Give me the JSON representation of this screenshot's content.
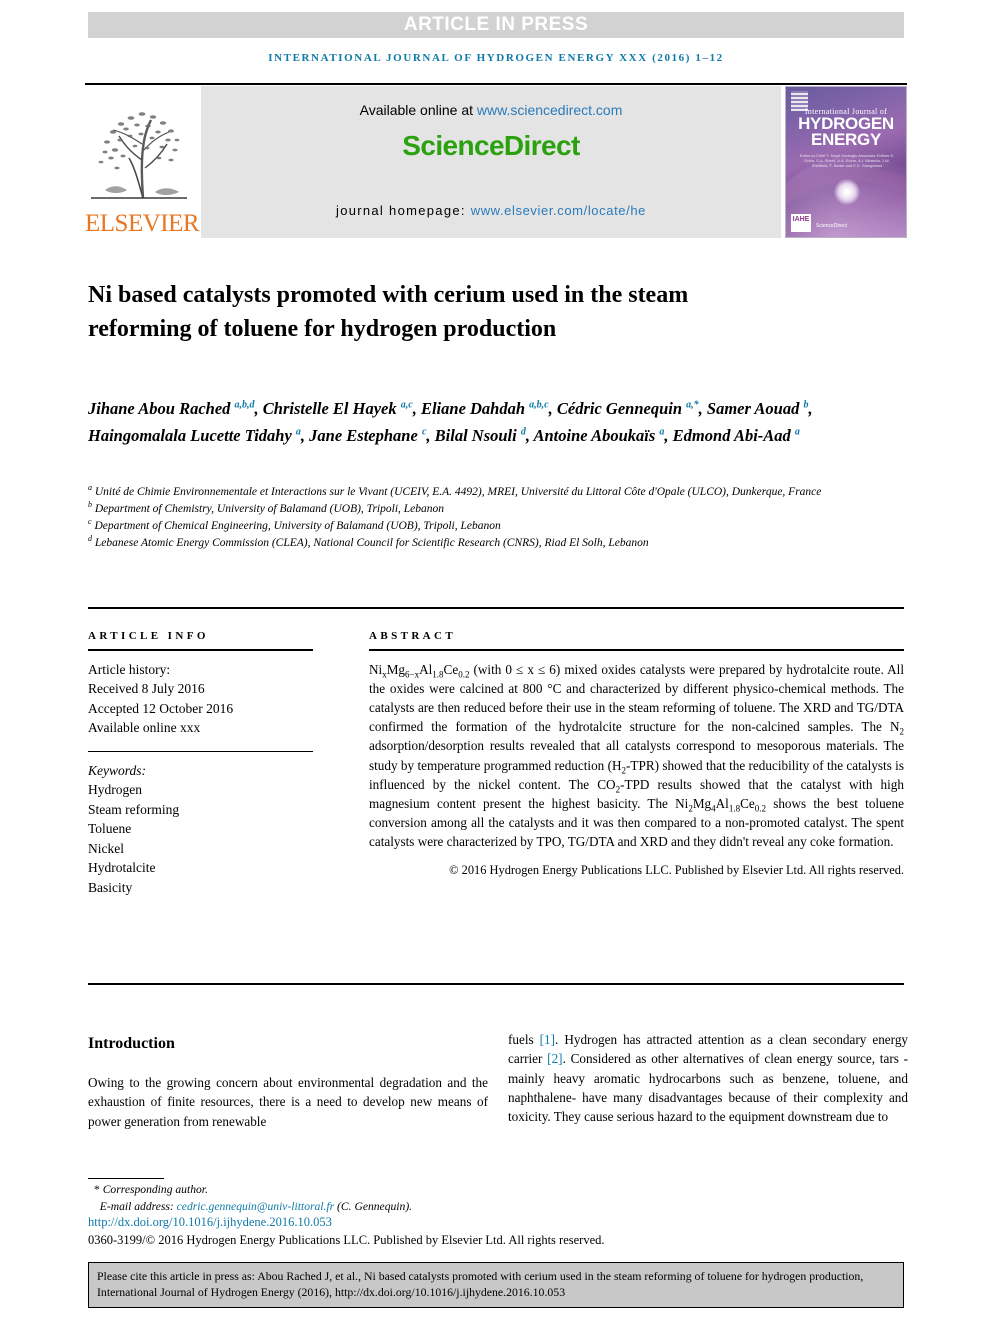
{
  "banner": {
    "text": "ARTICLE IN PRESS"
  },
  "running_head": {
    "text": "INTERNATIONAL JOURNAL OF HYDROGEN ENERGY XXX (2016) 1–12"
  },
  "masthead": {
    "publisher_name": "ELSEVIER",
    "available_label": "Available online at ",
    "available_url": "www.sciencedirect.com",
    "brand": "ScienceDirect",
    "homepage_label": "journal homepage: ",
    "homepage_url": "www.elsevier.com/locate/he"
  },
  "cover": {
    "line1": "International Journal of",
    "line2": "HYDROGEN",
    "line3": "ENERGY",
    "editors": "Editor-in-Chief  T. Nejat Veziroğlu   Associate Editors  S. Dutta, S.A. Sherif, A.A. Evers, A.I. Miranda, J.W. Sheffield, F. Barbir and E.E. Stangeland",
    "sciencedirect": "ScienceDirect",
    "badge": "IAHE"
  },
  "title": "Ni based catalysts promoted with cerium used in the steam reforming of toluene for hydrogen production",
  "authors": [
    {
      "name": "Jihane Abou Rached",
      "marks": "a,b,d",
      "sep": ", "
    },
    {
      "name": "Christelle El Hayek",
      "marks": "a,c",
      "sep": ", "
    },
    {
      "name": "Eliane Dahdah",
      "marks": "a,b,c",
      "sep": ", "
    },
    {
      "name": "Cédric Gennequin",
      "marks": "a,*",
      "sep": ", "
    },
    {
      "name": "Samer Aouad",
      "marks": "b",
      "sep": ", "
    },
    {
      "name": "Haingomalala Lucette Tidahy",
      "marks": "a",
      "sep": ", "
    },
    {
      "name": "Jane Estephane",
      "marks": "c",
      "sep": ", "
    },
    {
      "name": "Bilal Nsouli",
      "marks": "d",
      "sep": ", "
    },
    {
      "name": "Antoine Aboukaïs",
      "marks": "a",
      "sep": ", "
    },
    {
      "name": "Edmond Abi-Aad",
      "marks": "a",
      "sep": ""
    }
  ],
  "affiliations": [
    {
      "mark": "a",
      "text": "Unité de Chimie Environnementale et Interactions sur le Vivant (UCEIV, E.A. 4492), MREI, Université du Littoral Côte d'Opale (ULCO), Dunkerque, France"
    },
    {
      "mark": "b",
      "text": "Department of Chemistry, University of Balamand (UOB), Tripoli, Lebanon"
    },
    {
      "mark": "c",
      "text": "Department of Chemical Engineering, University of Balamand (UOB), Tripoli, Lebanon"
    },
    {
      "mark": "d",
      "text": "Lebanese Atomic Energy Commission (CLEA), National Council for Scientific Research (CNRS), Riad El Solh, Lebanon"
    }
  ],
  "article_info": {
    "heading": "ARTICLE INFO",
    "history_label": "Article history:",
    "received": "Received 8 July 2016",
    "accepted": "Accepted 12 October 2016",
    "available": "Available online xxx",
    "keywords_label": "Keywords:",
    "keywords": [
      "Hydrogen",
      "Steam reforming",
      "Toluene",
      "Nickel",
      "Hydrotalcite",
      "Basicity"
    ]
  },
  "abstract": {
    "heading": "ABSTRACT",
    "formula_main": {
      "pre": "Ni",
      "s1": "x",
      "mid1": "Mg",
      "s2": "6−x",
      "mid2": "Al",
      "s3": "1.8",
      "mid3": "Ce",
      "s4": "0.2"
    },
    "part1": " (with 0 ≤ x ≤ 6) mixed oxides catalysts were prepared by hydrotalcite route. All the oxides were calcined at 800 °C and characterized by different physico-chemical methods. The catalysts are then reduced before their use in the steam reforming of toluene. The XRD and TG/DTA confirmed the formation of the hydrotalcite structure for the non-calcined samples. The N",
    "sub_n2": "2",
    "part2": " adsorption/desorption results revealed that all catalysts correspond to mesoporous materials. The study by temperature programmed reduction (H",
    "sub_h2": "2",
    "part3": "-TPR) showed that the reducibility of the catalysts is influenced by the nickel content. The CO",
    "sub_co2": "2",
    "part4": "-TPD results showed that the catalyst with high magnesium content present the highest basicity. The ",
    "formula_best": {
      "pre": "Ni",
      "s1": "2",
      "mid1": "Mg",
      "s2": "4",
      "mid2": "Al",
      "s3": "1.8",
      "mid3": "Ce",
      "s4": "0.2"
    },
    "part5": " shows the best toluene conversion among all the catalysts and it was then compared to a non-promoted catalyst. The spent catalysts were characterized by TPO, TG/DTA and XRD and they didn't reveal any coke formation.",
    "copyright": "© 2016 Hydrogen Energy Publications LLC. Published by Elsevier Ltd. All rights reserved."
  },
  "introduction": {
    "heading": "Introduction",
    "left_text": "Owing to the growing concern about environmental degradation and the exhaustion of finite resources, there is a need to develop new means of power generation from renewable",
    "right": {
      "p1": "fuels ",
      "ref1": "[1]",
      "p2": ". Hydrogen has attracted attention as a clean secondary energy carrier ",
      "ref2": "[2]",
      "p3": ". Considered as other alternatives of clean energy source, tars -mainly heavy aromatic hydrocarbons such as benzene, toluene, and naphthalene- have many disadvantages because of their complexity and toxicity. They cause serious hazard to the equipment downstream due to"
    }
  },
  "footnotes": {
    "corresponding": "Corresponding author.",
    "email_label": "E-mail address: ",
    "email": "cedric.gennequin@univ-littoral.fr",
    "email_suffix": " (C. Gennequin).",
    "doi": "http://dx.doi.org/10.1016/j.ijhydene.2016.10.053",
    "issn": "0360-3199/© 2016 Hydrogen Energy Publications LLC. Published by Elsevier Ltd. All rights reserved."
  },
  "cite_box": {
    "text": "Please cite this article in press as: Abou Rached J, et al., Ni based catalysts promoted with cerium used in the steam reforming of toluene for hydrogen production, International Journal of Hydrogen Energy (2016), http://dx.doi.org/10.1016/j.ijhydene.2016.10.053"
  },
  "colors": {
    "link_blue": "#0f7aa8",
    "sd_green": "#2ba10f",
    "elsevier_orange": "#e87722",
    "banner_gray": "#d2d2d2",
    "cite_gray": "#c8c8c8"
  }
}
